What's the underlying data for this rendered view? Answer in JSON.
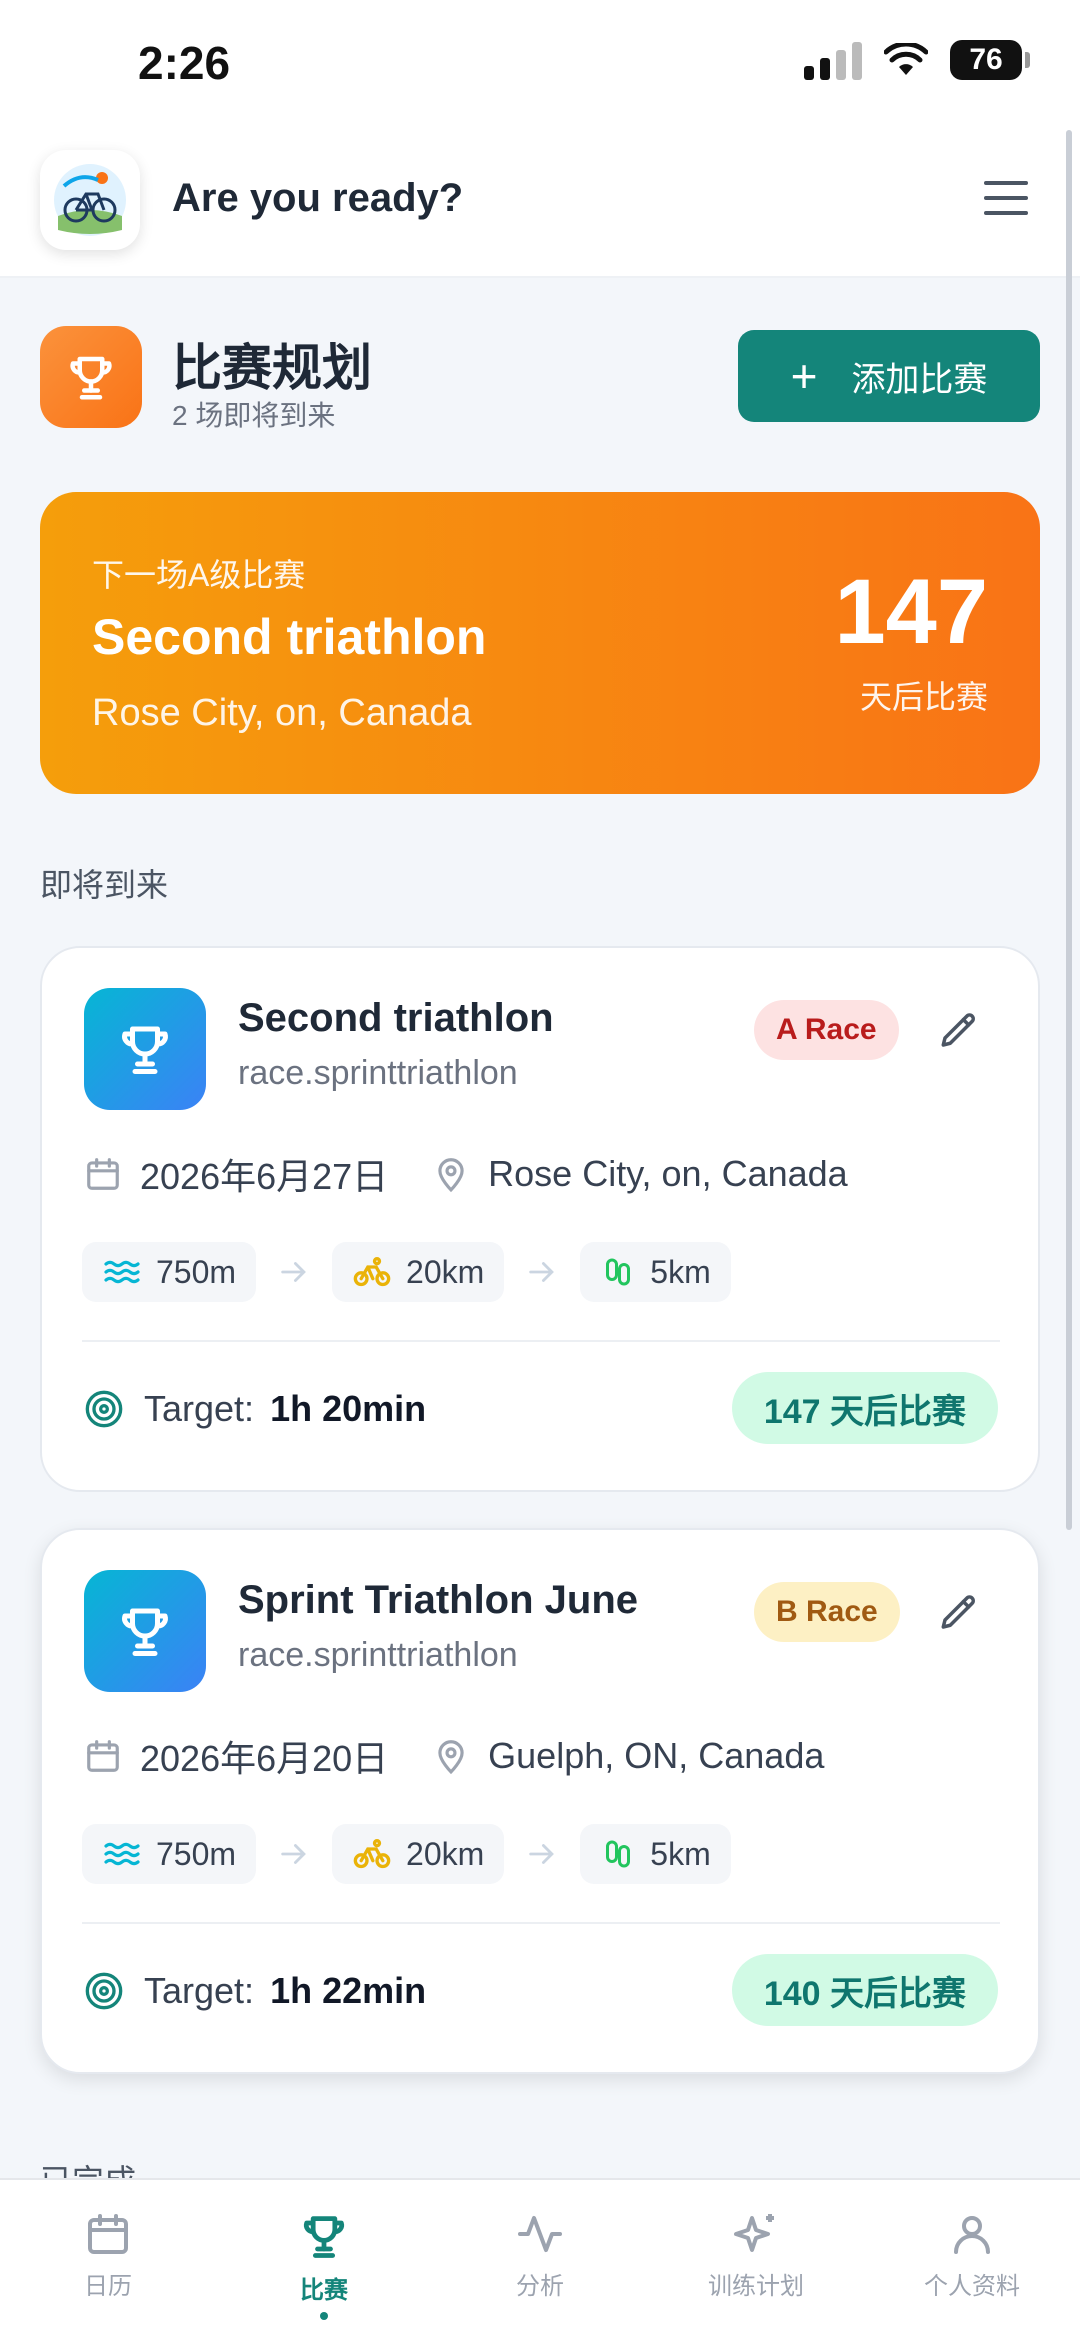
{
  "status_bar": {
    "time": "2:26",
    "battery": "76"
  },
  "header": {
    "title": "Are you ready?"
  },
  "page": {
    "title": "比赛规划",
    "subtitle": "2 场即将到来",
    "add_button_label": "添加比赛"
  },
  "hero": {
    "label": "下一场A级比赛",
    "race_name": "Second triathlon",
    "location": "Rose City, on, Canada",
    "days": "147",
    "days_label": "天后比赛"
  },
  "sections": {
    "upcoming": "即将到来",
    "completed": "已完成"
  },
  "races": [
    {
      "name": "Second triathlon",
      "type": "race.sprinttriathlon",
      "badge": "A Race",
      "date": "2026年6月27日",
      "location": "Rose City, on, Canada",
      "swim": "750m",
      "bike": "20km",
      "run": "5km",
      "target_label": "Target:",
      "target_time": "1h 20min",
      "days_until": "147 天后比赛"
    },
    {
      "name": "Sprint Triathlon June",
      "type": "race.sprinttriathlon",
      "badge": "B Race",
      "date": "2026年6月20日",
      "location": "Guelph, ON, Canada",
      "swim": "750m",
      "bike": "20km",
      "run": "5km",
      "target_label": "Target:",
      "target_time": "1h 22min",
      "days_until": "140 天后比赛"
    }
  ],
  "nav": [
    {
      "label": "日历",
      "icon": "calendar-icon"
    },
    {
      "label": "比赛",
      "icon": "trophy-icon",
      "active": true
    },
    {
      "label": "分析",
      "icon": "activity-icon"
    },
    {
      "label": "训练计划",
      "icon": "sparkles-icon"
    },
    {
      "label": "个人资料",
      "icon": "user-icon"
    }
  ],
  "colors": {
    "accent": "#14857a",
    "hero_start": "#f59e0b",
    "hero_end": "#f97316",
    "a_badge_bg": "#fde2e2",
    "b_badge_bg": "#fdf0c4",
    "days_pill_bg": "#d1fae5"
  }
}
